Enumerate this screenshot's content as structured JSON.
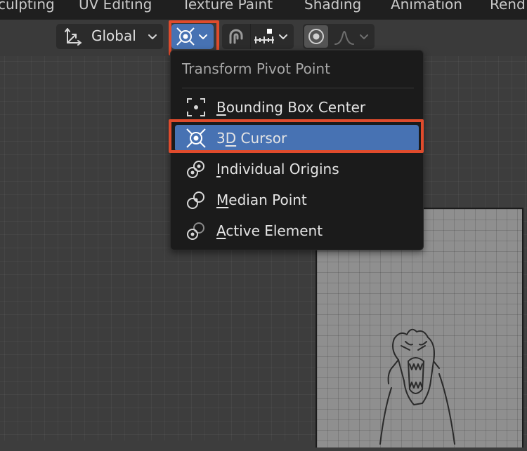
{
  "workspace_tabs": [
    {
      "label": "culpting"
    },
    {
      "label": "UV Editing"
    },
    {
      "label": "Texture Paint"
    },
    {
      "label": "Shading"
    },
    {
      "label": "Animation"
    },
    {
      "label": "Rend"
    }
  ],
  "header": {
    "orientation_label": "Global",
    "pivot_icon": "3d-cursor-icon",
    "snap_icon": "magnet-icon",
    "snap_target_icon": "snap-increment-icon",
    "proportional_icon": "proportional-edit-icon",
    "falloff_icon": "falloff-curve-icon"
  },
  "menu": {
    "title": "Transform Pivot Point",
    "items": [
      {
        "label": "Bounding Box Center",
        "accel": "B",
        "rest": "ounding Box Center",
        "icon": "bounding-box-center-icon",
        "selected": false
      },
      {
        "label": "3D Cursor",
        "pre": "3",
        "accel": "D",
        "rest": " Cursor",
        "icon": "3d-cursor-icon",
        "selected": true
      },
      {
        "label": "Individual Origins",
        "accel": "I",
        "rest": "ndividual Origins",
        "icon": "individual-origins-icon",
        "selected": false
      },
      {
        "label": "Median Point",
        "accel": "M",
        "rest": "edian Point",
        "icon": "median-point-icon",
        "selected": false
      },
      {
        "label": "Active Element",
        "accel": "A",
        "rest": "ctive Element",
        "icon": "active-element-icon",
        "selected": false
      }
    ]
  },
  "colors": {
    "accent": "#4772b3",
    "highlight": "#e04b2c",
    "menu_bg": "#1b1b1b",
    "viewport_bg": "#3d3d3d"
  }
}
